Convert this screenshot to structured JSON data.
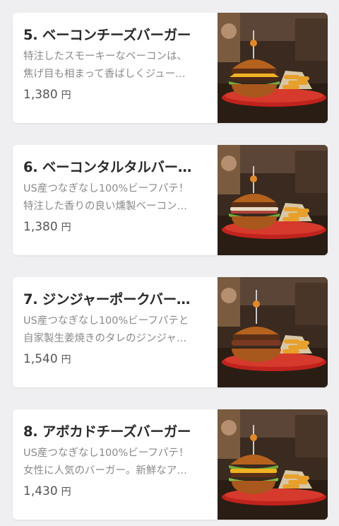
{
  "menu_items": [
    {
      "title": "5. ベーコンチーズバーガー",
      "desc_line1": "特注したスモーキーなベーコンは、",
      "desc_line2": "焦げ目も相まって香ばしくジュー…",
      "price": "1,380",
      "currency": "円",
      "image": "burger-with-fries-photo"
    },
    {
      "title": "6. ベーコンタルタルバー…",
      "desc_line1": "US産つなぎなし100%ビーフパテ！",
      "desc_line2": "特注した香りの良い燻製ベーコン…",
      "price": "1,380",
      "currency": "円",
      "image": "burger-with-fries-photo"
    },
    {
      "title": "7. ジンジャーポークバー…",
      "desc_line1": "US産つなぎなし100%ビーフパテと",
      "desc_line2": "自家製生姜焼きのタレのジンジャ…",
      "price": "1,540",
      "currency": "円",
      "image": "burger-with-fries-photo"
    },
    {
      "title": "8. アボカドチーズバーガー",
      "desc_line1": "US産つなぎなし100%ビーフパテ！",
      "desc_line2": "女性に人気のバーガー。新鮮なア…",
      "price": "1,430",
      "currency": "円",
      "image": "burger-with-fries-photo"
    }
  ],
  "colors": {
    "background": "#efeff1",
    "card": "#ffffff",
    "title": "#2b2b2b",
    "description": "#8a8a8a",
    "price": "#555555",
    "plate": "#c0231d",
    "bun": "#b5621f"
  }
}
